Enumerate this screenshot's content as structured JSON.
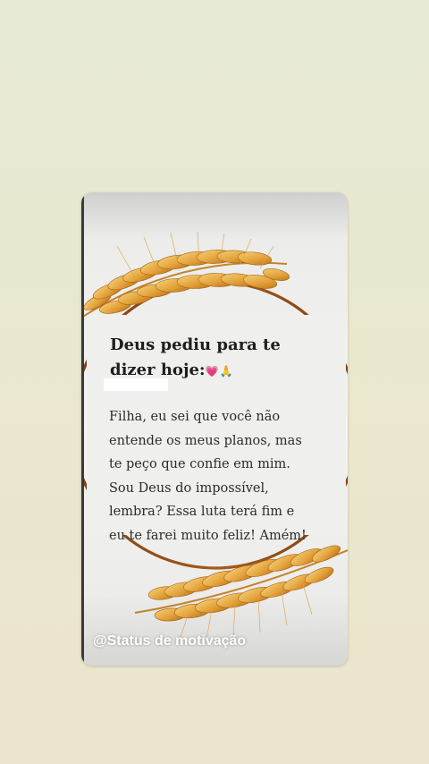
{
  "post": {
    "heading_line1": "Deus pediu para te",
    "heading_line2": "dizer hoje:",
    "heading_emoji": "💗🙏",
    "body_lines": [
      "Filha, eu sei que você não",
      "entende os meus planos, mas",
      "te peço que confie em mim.",
      "Sou Deus do impossível,",
      "lembra? Essa luta terá fim e",
      "eu te farei muito feliz! Amém!"
    ],
    "watermark": "@Status de motivação"
  },
  "colors": {
    "page_background": "#e7e8d2",
    "card_background": "#f0f0ee",
    "wheat_gold": "#e3a63c",
    "wheat_dark": "#b96d16",
    "ring_brown": "#8b4a14",
    "text": "#2b2b2b"
  },
  "icons": {
    "wreath": "wheat-wreath-illustration",
    "emoji": "heart-and-praying-hands"
  }
}
